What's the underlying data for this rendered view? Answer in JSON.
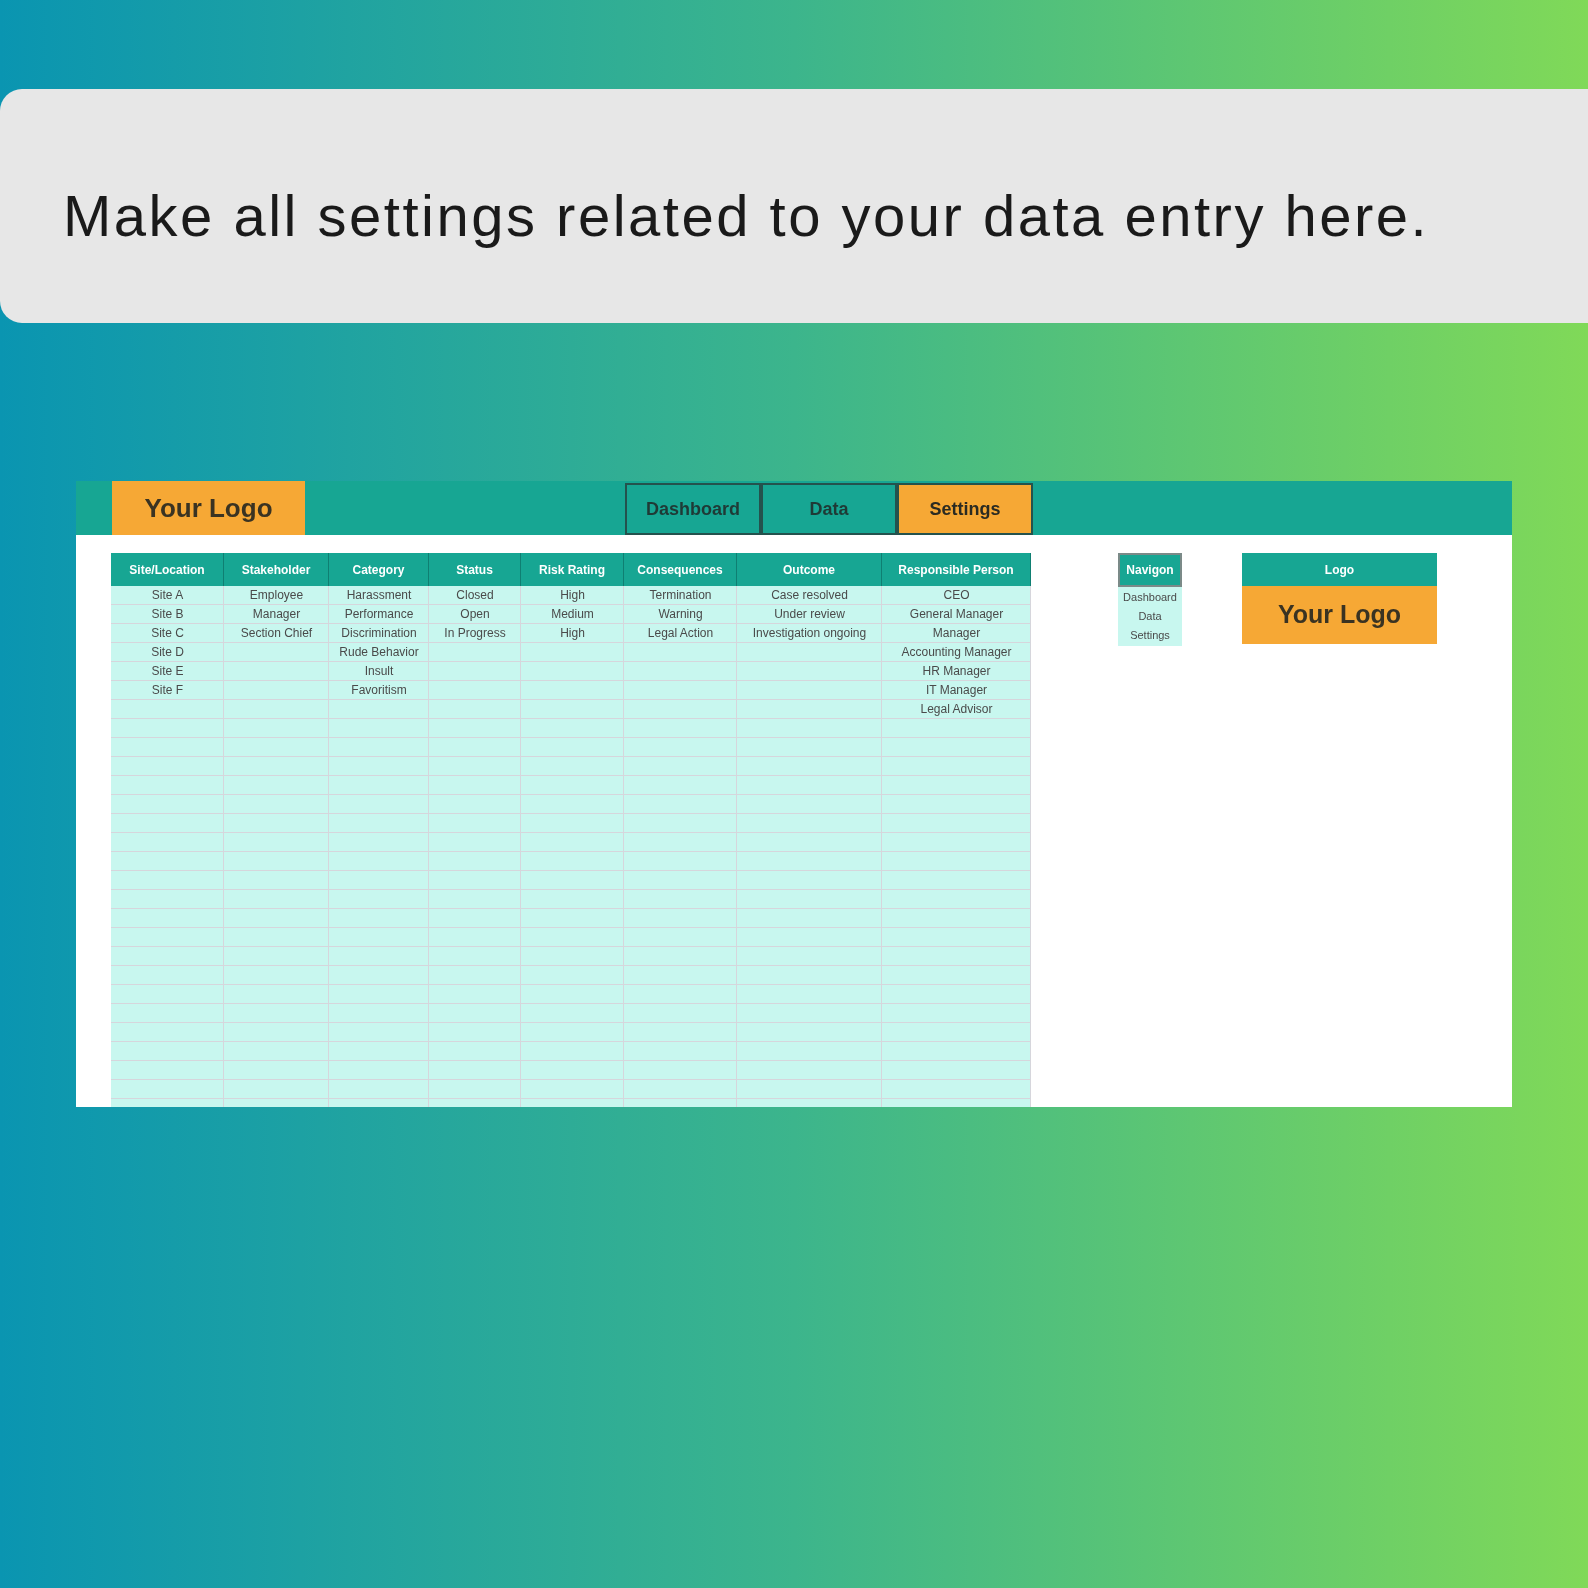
{
  "banner": {
    "text": "Make all settings related to your data entry here."
  },
  "sheet": {
    "logo": "Your Logo",
    "tabs": [
      {
        "label": "Dashboard",
        "selected": false
      },
      {
        "label": "Data",
        "selected": false
      },
      {
        "label": "Settings",
        "selected": true
      }
    ],
    "table": {
      "columns": [
        {
          "header": "Site/Location",
          "values": [
            "Site A",
            "Site B",
            "Site C",
            "Site D",
            "Site E",
            "Site F"
          ]
        },
        {
          "header": "Stakeholder",
          "values": [
            "Employee",
            "Manager",
            "Section Chief"
          ]
        },
        {
          "header": "Category",
          "values": [
            "Harassment",
            "Performance",
            "Discrimination",
            "Rude Behavior",
            "Insult",
            "Favoritism"
          ]
        },
        {
          "header": "Status",
          "values": [
            "Closed",
            "Open",
            "In Progress"
          ]
        },
        {
          "header": "Risk Rating",
          "values": [
            "High",
            "Medium",
            "High"
          ]
        },
        {
          "header": "Consequences",
          "values": [
            "Termination",
            "Warning",
            "Legal Action"
          ]
        },
        {
          "header": "Outcome",
          "values": [
            "Case resolved",
            "Under review",
            "Investigation ongoing"
          ]
        },
        {
          "header": "Responsible Person",
          "values": [
            "CEO",
            "General Manager",
            "Manager",
            "Accounting Manager",
            "HR Manager",
            "IT Manager",
            "Legal Advisor"
          ]
        }
      ]
    },
    "navigation": {
      "header": "Navigon",
      "items": [
        "Dashboard",
        "Data",
        "Settings"
      ]
    },
    "logo_box": {
      "header": "Logo",
      "text": "Your Logo"
    }
  }
}
